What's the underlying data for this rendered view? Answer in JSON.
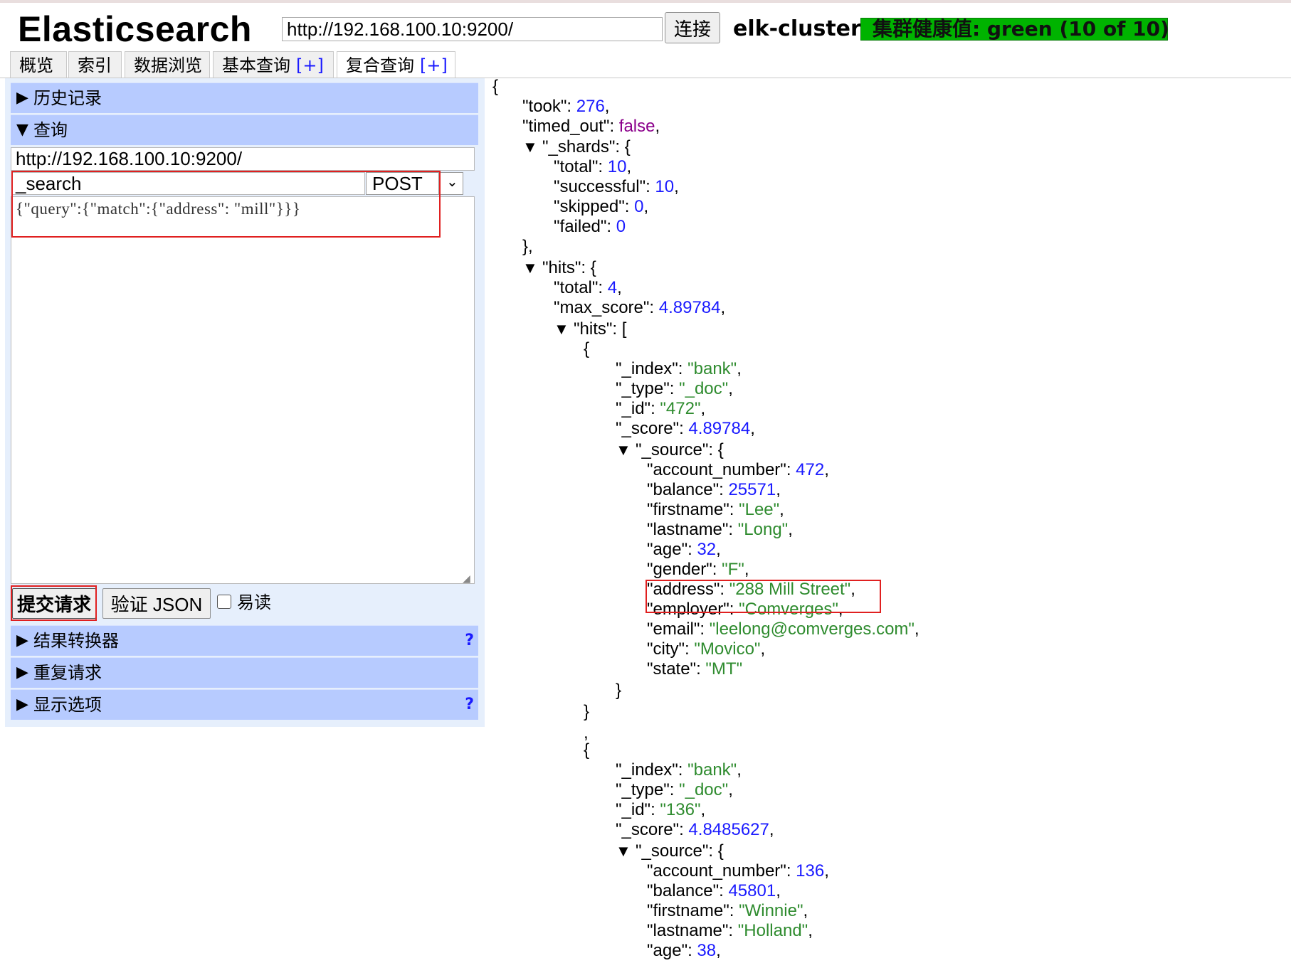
{
  "app": {
    "title": "Elasticsearch",
    "url": "http://192.168.100.10:9200/",
    "connect_label": "连接",
    "cluster_name": "elk-cluster",
    "health_text": "集群健康值: green (10 of 10)",
    "health_color": "#00b300"
  },
  "tabs": [
    {
      "label": "概览"
    },
    {
      "label": "索引"
    },
    {
      "label": "数据浏览"
    },
    {
      "label": "基本查询",
      "plus": "[+]"
    },
    {
      "label": "复合查询",
      "plus": "[+]"
    }
  ],
  "sidebar": {
    "history": {
      "arrow": "▶",
      "label": "历史记录"
    },
    "query": {
      "arrow": "▼",
      "label": "查询"
    },
    "query_url": "http://192.168.100.10:9200/",
    "path": "_search",
    "method": "POST",
    "body": "{\"query\":{\"match\":{\"address\": \"mill\"}}}",
    "submit_label": "提交请求",
    "validate_label": "验证 JSON",
    "pretty_label": "易读",
    "pretty_checked": false,
    "transformer": {
      "arrow": "▶",
      "label": "结果转换器",
      "help": "?"
    },
    "repeat": {
      "arrow": "▶",
      "label": "重复请求"
    },
    "display_options": {
      "arrow": "▶",
      "label": "显示选项",
      "help": "?"
    }
  },
  "response": {
    "took": 276,
    "timed_out": "false",
    "shards": {
      "total": 10,
      "successful": 10,
      "skipped": 0,
      "failed": 0
    },
    "hits_total": 4,
    "max_score": "4.89784",
    "hits": [
      {
        "_index": "\"bank\"",
        "_type": "\"_doc\"",
        "_id": "\"472\"",
        "_score": "4.89784",
        "source": {
          "account_number": 472,
          "balance": 25571,
          "firstname": "\"Lee\"",
          "lastname": "\"Long\"",
          "age": 32,
          "gender": "\"F\"",
          "address": "\"288 Mill Street\"",
          "employer": "\"Comverges\"",
          "email": "\"leelong@comverges.com\"",
          "city": "\"Movico\"",
          "state": "\"MT\""
        }
      },
      {
        "_index": "\"bank\"",
        "_type": "\"_doc\"",
        "_id": "\"136\"",
        "_score": "4.8485627",
        "source": {
          "account_number": 136,
          "balance": 45801,
          "firstname": "\"Winnie\"",
          "lastname": "\"Holland\"",
          "age": 38
        }
      }
    ]
  }
}
